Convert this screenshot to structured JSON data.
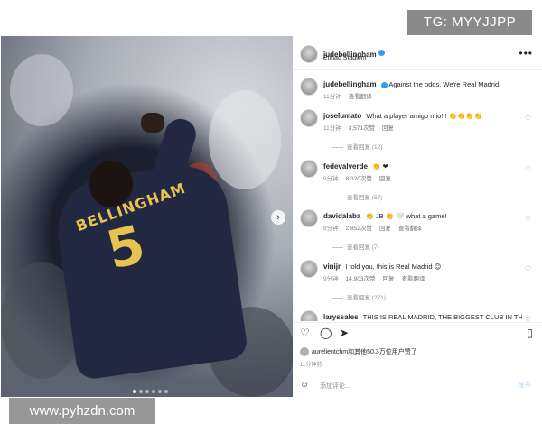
{
  "post": {
    "author": "judebellingham",
    "location": "Etihad Stadium",
    "caption_author": "judebellingham",
    "caption": "Against the odds. We're Real Madrid.",
    "caption_time": "11分钟",
    "caption_translate": "查看翻译",
    "jersey_name": "BELLINGHAM",
    "jersey_number": "5"
  },
  "comments": [
    {
      "user": "joselumato",
      "text": "What a player amigo mio!!! 👏👏👏👏",
      "time": "11分钟",
      "likes": "3,571次赞",
      "reply": "回复",
      "translate": "",
      "replies": "查看回复 (12)"
    },
    {
      "user": "fedevalverde",
      "text": "👏 ❤",
      "time": "9分钟",
      "likes": "8,320次赞",
      "reply": "回复",
      "translate": "",
      "replies": "查看回复 (57)"
    },
    {
      "user": "davidalaba",
      "text": "👏 JB 👏 🤍 what a game!",
      "time": "8分钟",
      "likes": "2,852次赞",
      "reply": "回复",
      "translate": "查看翻译",
      "replies": "查看回复 (7)"
    },
    {
      "user": "vinijr",
      "text": "I told you, this is Real Madrid 😊",
      "time": "9分钟",
      "likes": "14,903次赞",
      "reply": "回复",
      "translate": "查看翻译",
      "replies": "查看回复 (271)"
    },
    {
      "user": "laryssales",
      "text": "THIS IS REAL MADRID, THE BIGGEST CLUB IN THE",
      "time": "",
      "likes": "",
      "reply": "",
      "translate": "",
      "replies": ""
    }
  ],
  "liked_by": "aurelientchm和其他50.3万位用户赞了",
  "footer_time": "11分钟前",
  "comment_placeholder": "添加评论...",
  "post_button": "发布",
  "watermark_top": "TG: MYYJJPP",
  "watermark_bottom": "www.pyhzdn.com",
  "colors": {
    "verified": "#3897f0",
    "jersey_gold": "#e7c350",
    "jersey_navy": "#232842"
  }
}
